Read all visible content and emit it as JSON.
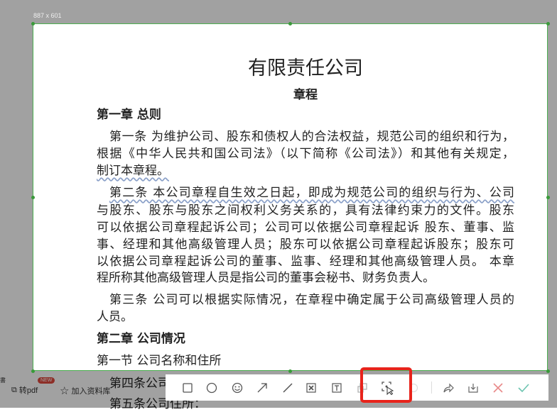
{
  "selection": {
    "size_label": "887 x 601"
  },
  "document": {
    "title": "有限责任公司",
    "subtitle": "章程",
    "lines": [
      "第一章  总则",
      "第一条 为维护公司、股东和债权人的合法权益，规范公司的组织和行为，",
      "根据《中华人民共和国公司法》（以下简称《公司法》）和其他有关规定，",
      "制订本章程。",
      "第二条 本公司章程自生效之日起，即成为规范公司的组织与行为、公司",
      "与股东、股东与股东之间权利义务关系的，具有法律约束力的文件。股东",
      "可以依据公司章程起诉公司；公司可以依据公司章程起诉  股东、董事、监",
      "事、经理和其他高级管理人员；股东可以依据公司章程起诉股东；股东可",
      "以依据公司章程起诉公司的董事、监事、经理和其他高级管理人员。   本章",
      "程所称其他高级管理人员是指公司的董事会秘书、财务负责人。",
      "第三条 公司可以根据实际情况，在章程中确定属于公司高级管理人员的",
      "人员。",
      "第二章  公司情况",
      "第一节  公司名称和住所",
      "第四条公司名称：",
      "第五条公司住所："
    ]
  },
  "background_app": {
    "to_pdf": "转pdf",
    "new_badge": "NEW",
    "add_to_library": "加入资料库",
    "left_edge": "書"
  },
  "toolbar": {
    "tools": [
      "rectangle",
      "ellipse",
      "emoji",
      "arrow",
      "line",
      "mosaic",
      "text",
      "pin",
      "ocr-select",
      "undo",
      "share",
      "save",
      "cancel",
      "confirm"
    ]
  },
  "colors": {
    "selection_border": "#4caf50",
    "highlight": "#e8231b",
    "cancel": "#e88a8a",
    "confirm": "#6cc4b0"
  }
}
